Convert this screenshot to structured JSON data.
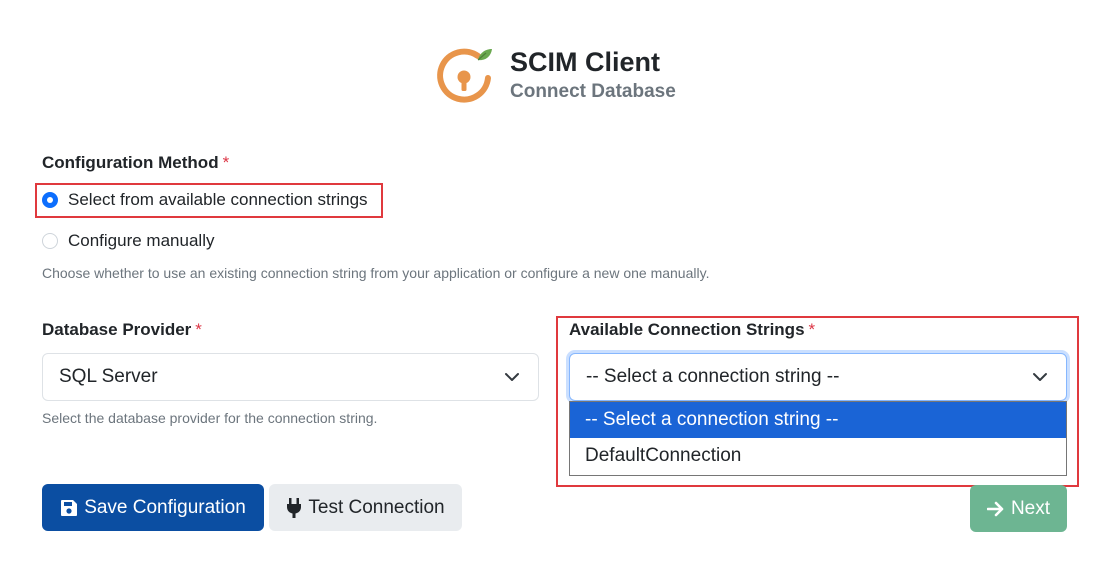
{
  "header": {
    "title": "SCIM Client",
    "subtitle": "Connect Database",
    "logo_icon": "key-lock-logo-icon",
    "colors": {
      "logo_orange": "#e8954b",
      "logo_leaf": "#6aa84f"
    }
  },
  "config_method": {
    "label": "Configuration Method",
    "required_mark": "*",
    "options": [
      {
        "label": "Select from available connection strings",
        "checked": true
      },
      {
        "label": "Configure manually",
        "checked": false
      }
    ],
    "help": "Choose whether to use an existing connection string from your application or configure a new one manually."
  },
  "provider": {
    "label": "Database Provider",
    "required_mark": "*",
    "value": "SQL Server",
    "help": "Select the database provider for the connection string."
  },
  "connection_strings": {
    "label": "Available Connection Strings",
    "required_mark": "*",
    "value": "-- Select a connection string --",
    "options": [
      {
        "label": "-- Select a connection string --",
        "selected": true
      },
      {
        "label": "DefaultConnection",
        "selected": false
      }
    ]
  },
  "buttons": {
    "save": "Save Configuration",
    "test": "Test Connection",
    "next": "Next"
  },
  "icons": {
    "save": "floppy-disk-icon",
    "test": "plug-icon",
    "next": "arrow-right-icon",
    "dropdown": "chevron-down-icon"
  },
  "colors": {
    "primary": "#0b4ea2",
    "success_muted": "#6db592",
    "highlight_border": "#e0393e",
    "required": "#dc3545",
    "dropdown_selected": "#1a64d6"
  }
}
